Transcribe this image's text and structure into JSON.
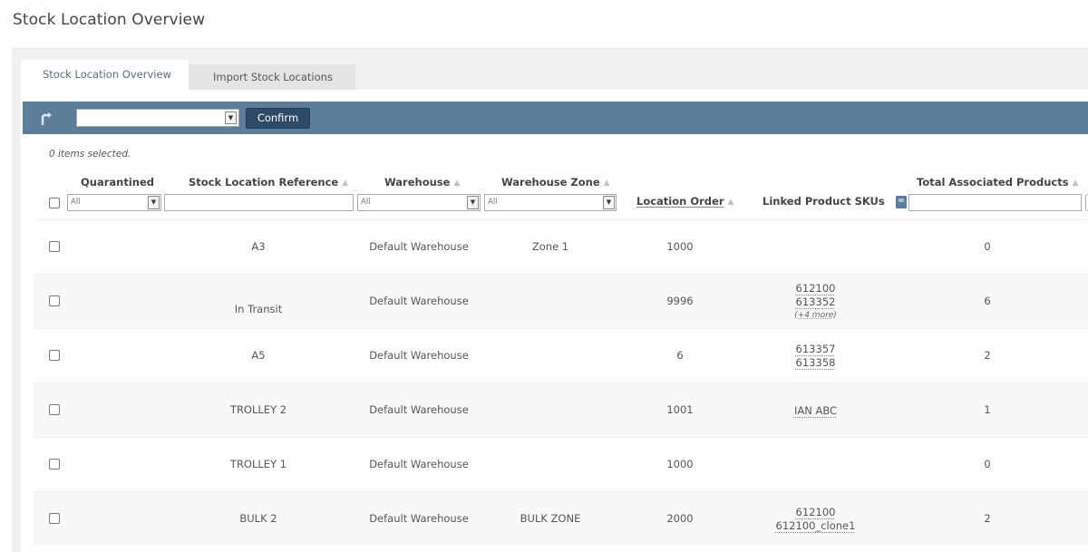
{
  "page": {
    "title": "Stock Location Overview"
  },
  "tabs": [
    {
      "label": "Stock Location Overview",
      "active": true
    },
    {
      "label": "Import Stock Locations",
      "active": false
    }
  ],
  "toolbar": {
    "action_select_value": "",
    "confirm_label": "Confirm",
    "back_icon": "return-arrow-icon"
  },
  "selection": {
    "count_text": "0 items selected."
  },
  "columns": {
    "quarantined": "Quarantined",
    "reference": "Stock Location Reference",
    "warehouse": "Warehouse",
    "zone": "Warehouse Zone",
    "location_order": "Location Order",
    "linked_skus": "Linked Product SKUs",
    "total_products": "Total Associated Products"
  },
  "filters": {
    "quarantined": "All",
    "reference": "",
    "warehouse": "All",
    "zone": "All",
    "total_operator": "=",
    "total_value": ""
  },
  "rows": [
    {
      "reference": "A3",
      "warehouse": "Default Warehouse",
      "zone": "Zone 1",
      "location_order": "1000",
      "skus": [],
      "more": "",
      "total": "0"
    },
    {
      "reference": "In Transit",
      "warehouse": "Default Warehouse",
      "zone": "",
      "location_order": "9996",
      "skus": [
        "612100",
        "613352"
      ],
      "more": "(+4 more)",
      "total": "6"
    },
    {
      "reference": "A5",
      "warehouse": "Default Warehouse",
      "zone": "",
      "location_order": "6",
      "skus": [
        "613357",
        "613358"
      ],
      "more": "",
      "total": "2"
    },
    {
      "reference": "TROLLEY 2",
      "warehouse": "Default Warehouse",
      "zone": "",
      "location_order": "1001",
      "skus": [
        "IAN ABC"
      ],
      "more": "",
      "total": "1"
    },
    {
      "reference": "TROLLEY 1",
      "warehouse": "Default Warehouse",
      "zone": "",
      "location_order": "1000",
      "skus": [],
      "more": "",
      "total": "0"
    },
    {
      "reference": "BULK 2",
      "warehouse": "Default Warehouse",
      "zone": "BULK ZONE",
      "location_order": "2000",
      "skus": [
        "612100",
        "612100_clone1"
      ],
      "more": "",
      "total": "2"
    }
  ],
  "colors": {
    "toolbar": "#5e7d9a",
    "confirm": "#2e4a66",
    "panel_bg": "#f1f1f1"
  }
}
